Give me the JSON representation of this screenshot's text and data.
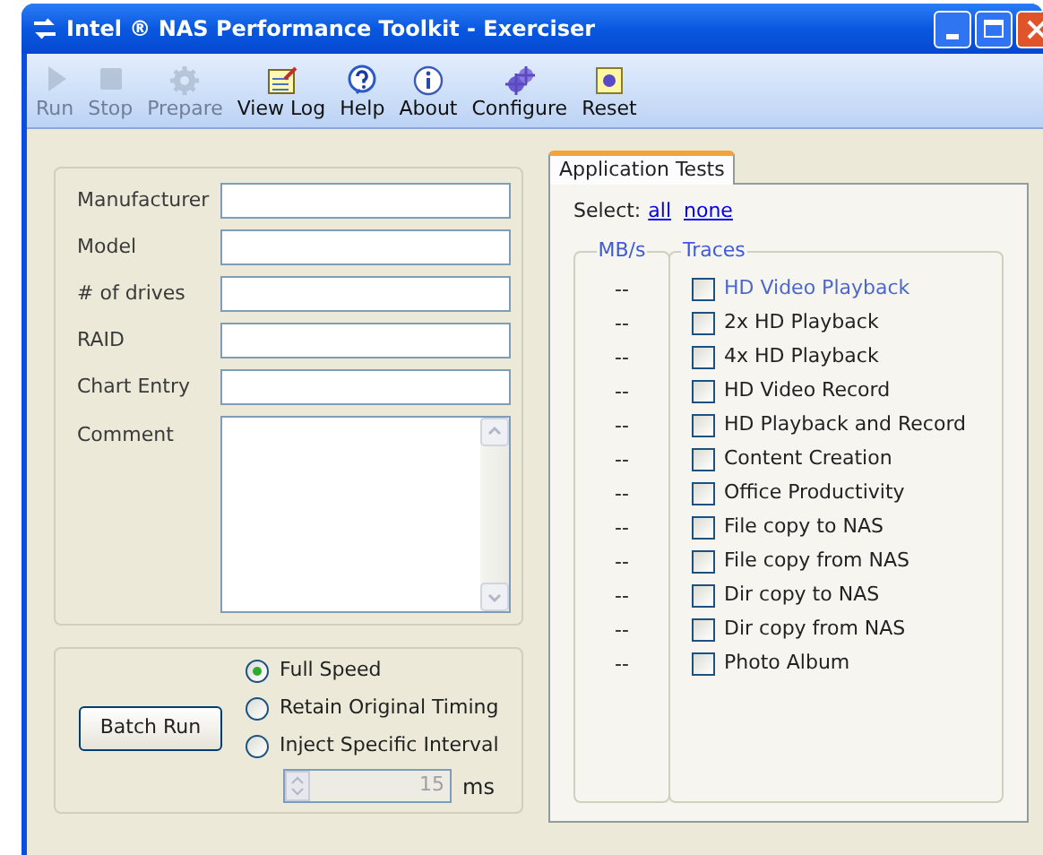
{
  "window": {
    "title": "Intel ® NAS Performance Toolkit - Exerciser"
  },
  "toolbar": [
    {
      "label": "Run",
      "kind": "play",
      "disabled": true
    },
    {
      "label": "Stop",
      "kind": "stop",
      "disabled": true
    },
    {
      "label": "Prepare",
      "kind": "gear",
      "disabled": true
    },
    {
      "label": "View Log",
      "kind": "notepad",
      "disabled": false
    },
    {
      "label": "Help",
      "kind": "question",
      "disabled": false
    },
    {
      "label": "About",
      "kind": "info",
      "disabled": false
    },
    {
      "label": "Configure",
      "kind": "gears",
      "disabled": false
    },
    {
      "label": "Reset",
      "kind": "reset",
      "disabled": false
    }
  ],
  "form": {
    "fields": [
      {
        "label": "Manufacturer"
      },
      {
        "label": "Model"
      },
      {
        "label": "# of drives"
      },
      {
        "label": "RAID"
      },
      {
        "label": "Chart Entry"
      }
    ],
    "comment": {
      "label": "Comment"
    }
  },
  "batch": {
    "button": "Batch Run",
    "modes": [
      {
        "label": "Full Speed",
        "selected": true
      },
      {
        "label": "Retain Original Timing",
        "selected": false
      },
      {
        "label": "Inject Specific Interval",
        "selected": false
      }
    ],
    "interval": {
      "value": "15",
      "unit": "ms",
      "disabled": true
    }
  },
  "tests": {
    "tab": {
      "label": "Application Tests",
      "selected": true
    },
    "select_label": "Select:",
    "links": [
      "all",
      "none"
    ],
    "columns": [
      "MB/s",
      "Traces"
    ],
    "traces": [
      {
        "mbps": "--",
        "label": "HD Video Playback",
        "checked": false,
        "highlighted": true
      },
      {
        "mbps": "--",
        "label": "2x HD Playback",
        "checked": false,
        "highlighted": false
      },
      {
        "mbps": "--",
        "label": "4x HD Playback",
        "checked": false,
        "highlighted": false
      },
      {
        "mbps": "--",
        "label": "HD Video Record",
        "checked": false,
        "highlighted": false
      },
      {
        "mbps": "--",
        "label": "HD Playback and Record",
        "checked": false,
        "highlighted": false
      },
      {
        "mbps": "--",
        "label": "Content Creation",
        "checked": false,
        "highlighted": false
      },
      {
        "mbps": "--",
        "label": "Office Productivity",
        "checked": false,
        "highlighted": false
      },
      {
        "mbps": "--",
        "label": "File copy to NAS",
        "checked": false,
        "highlighted": false
      },
      {
        "mbps": "--",
        "label": "File copy from NAS",
        "checked": false,
        "highlighted": false
      },
      {
        "mbps": "--",
        "label": "Dir copy to NAS",
        "checked": false,
        "highlighted": false
      },
      {
        "mbps": "--",
        "label": "Dir copy from NAS",
        "checked": false,
        "highlighted": false
      },
      {
        "mbps": "--",
        "label": "Photo Album",
        "checked": false,
        "highlighted": false
      }
    ]
  }
}
